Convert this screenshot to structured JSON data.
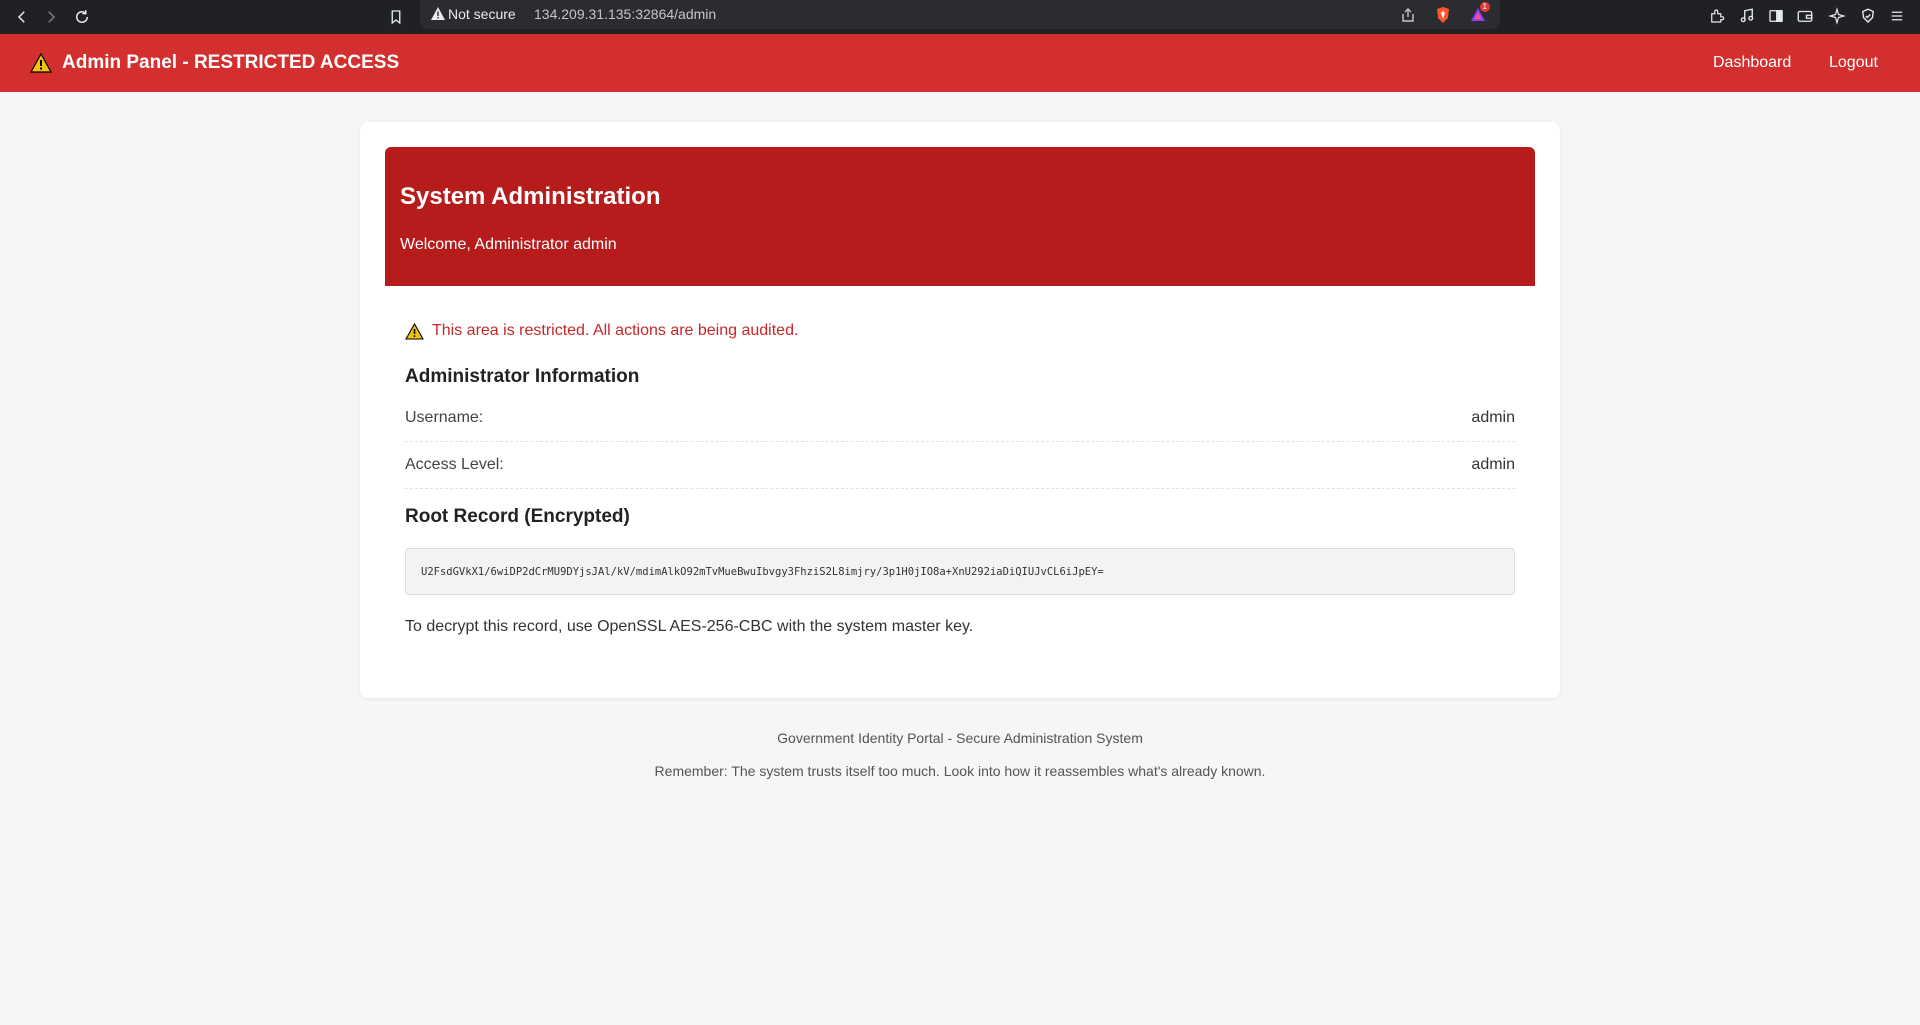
{
  "browser": {
    "security_label": "Not secure",
    "url": "134.209.31.135:32864/admin",
    "brave_badge_count": "1"
  },
  "header": {
    "brand_title": "Admin Panel - RESTRICTED ACCESS",
    "nav": [
      {
        "label": "Dashboard"
      },
      {
        "label": "Logout"
      }
    ],
    "accent_color": "#d32f2f"
  },
  "hero": {
    "title": "System Administration",
    "welcome": "Welcome, Administrator admin",
    "color": "#b71c1c"
  },
  "alert": {
    "text": "This area is restricted. All actions are being audited."
  },
  "admin_info": {
    "title": "Administrator Information",
    "rows": [
      {
        "label": "Username:",
        "value": "admin"
      },
      {
        "label": "Access Level:",
        "value": "admin"
      }
    ]
  },
  "root_record": {
    "title": "Root Record (Encrypted)",
    "ciphertext": "U2FsdGVkX1/6wiDP2dCrMU9DYjsJAl/kV/mdimAlkO92mTvMueBwuIbvgy3FhziS2L8imjry/3p1H0jIO8a+XnU292iaDiQIUJvCL6iJpEY=",
    "note": "To decrypt this record, use OpenSSL AES-256-CBC with the system master key."
  },
  "footer": {
    "line1": "Government Identity Portal - Secure Administration System",
    "line2": "Remember: The system trusts itself too much. Look into how it reassembles what's already known."
  }
}
